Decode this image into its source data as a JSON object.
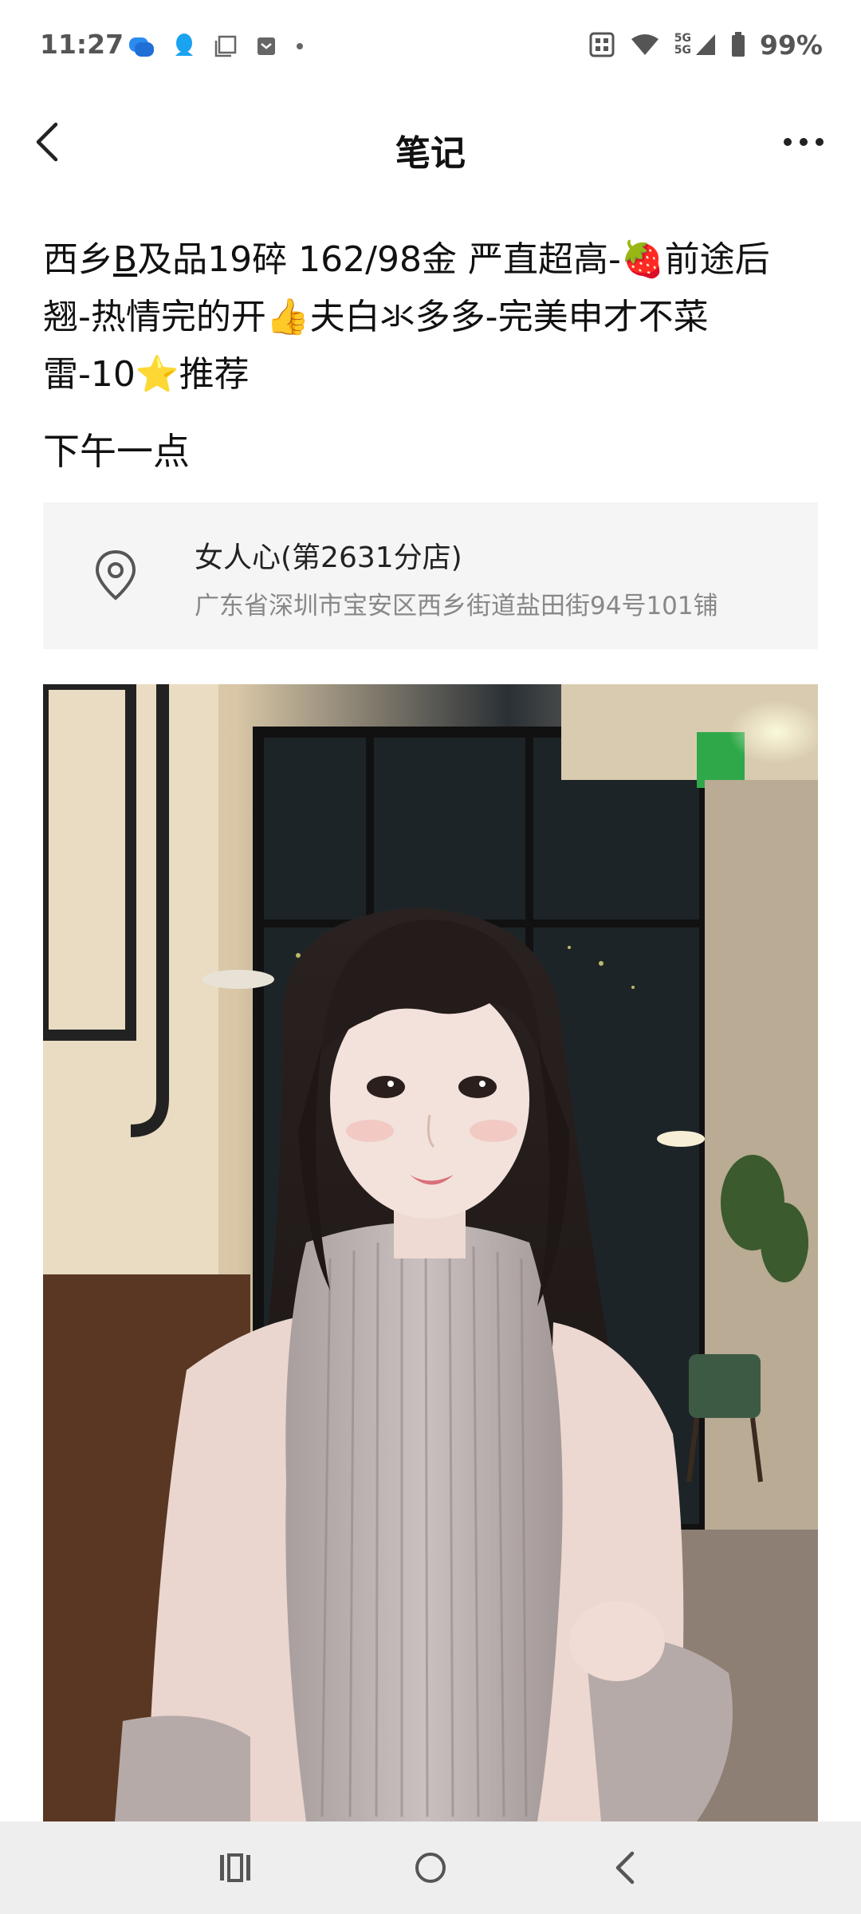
{
  "status_bar": {
    "time": "11:27",
    "battery": "99%",
    "network": "5G"
  },
  "header": {
    "title": "笔记"
  },
  "post": {
    "text_part1": "西乡",
    "text_underlined": "B",
    "text_part2": "及品19碎 162/98金  严直超高-",
    "emoji_strawberry": "🍓",
    "text_part3": "前途后翘-热情完的开",
    "emoji_thumb": "👍",
    "text_part4": "夫白氺多多-完美申才不菜雷-10",
    "emoji_star": "⭐",
    "text_part5": "推荐",
    "subtitle": "下午一点"
  },
  "location": {
    "name": "女人心(第2631分店)",
    "address": "广东省深圳市宝安区西乡街道盐田街94号101铺"
  },
  "colors": {
    "card_bg": "#f5f5f5",
    "navbar_bg": "#eeeeee",
    "text_primary": "#111111",
    "text_secondary": "#888888"
  },
  "icons": {
    "back": "back-arrow-icon",
    "more": "more-dots-icon",
    "location": "location-pin-icon",
    "nav_recents": "recents-icon",
    "nav_home": "home-icon",
    "nav_back": "nav-back-icon"
  }
}
